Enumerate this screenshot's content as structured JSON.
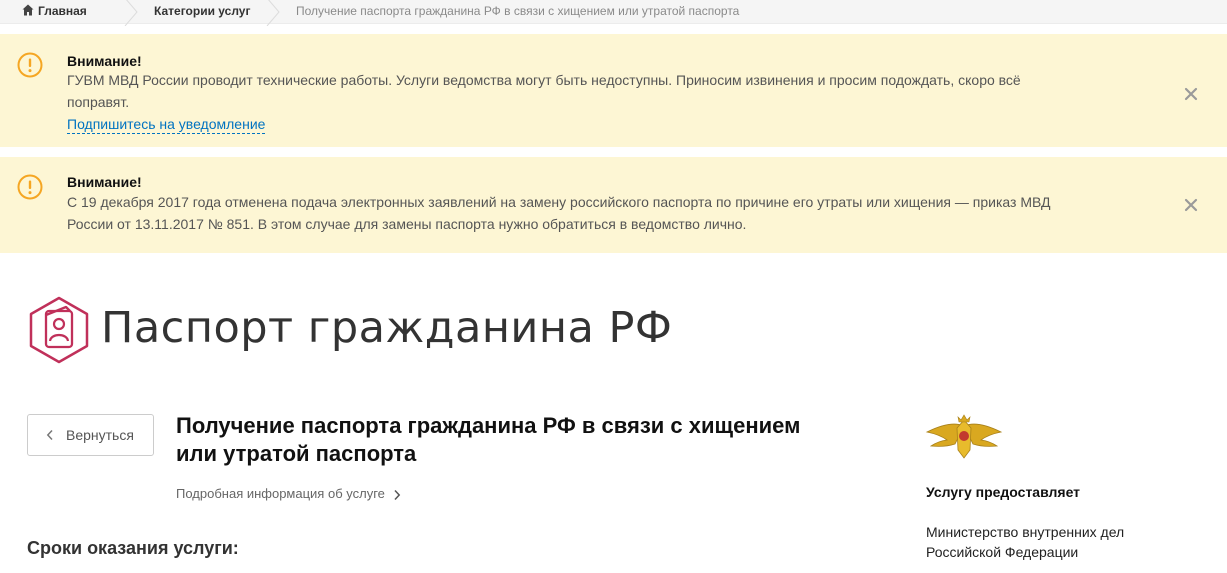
{
  "breadcrumb": {
    "home": "Главная",
    "categories": "Категории услуг",
    "current": "Получение паспорта гражданина РФ в связи с хищением или утратой паспорта"
  },
  "alerts": [
    {
      "title": "Внимание!",
      "text": "ГУВМ МВД России проводит технические работы. Услуги ведомства могут быть недоступны. Приносим извинения и просим подождать, скоро всё поправят.",
      "link": "Подпишитесь на уведомление"
    },
    {
      "title": "Внимание!",
      "text": "С 19 декабря 2017 года отменена подача электронных заявлений на замену российского паспорта по причине его утраты или хищения — приказ МВД России от 13.11.2017 № 851. В этом случае для замены паспорта нужно обратиться в ведомство лично."
    }
  ],
  "page": {
    "title": "Паспорт гражданина РФ",
    "back_label": "Вернуться",
    "service_title": "Получение паспорта гражданина РФ в связи с хищением или утратой паспорта",
    "more_info": "Подробная информация об услуге",
    "section_heading": "Сроки оказания услуги:"
  },
  "provider": {
    "title": "Услугу предоставляет",
    "name": "Министерство внутренних дел Российской Федерации"
  },
  "colors": {
    "alert_bg": "#fdf6d4",
    "warning": "#f5a623",
    "link": "#0173c1",
    "brand": "#c0305a"
  }
}
